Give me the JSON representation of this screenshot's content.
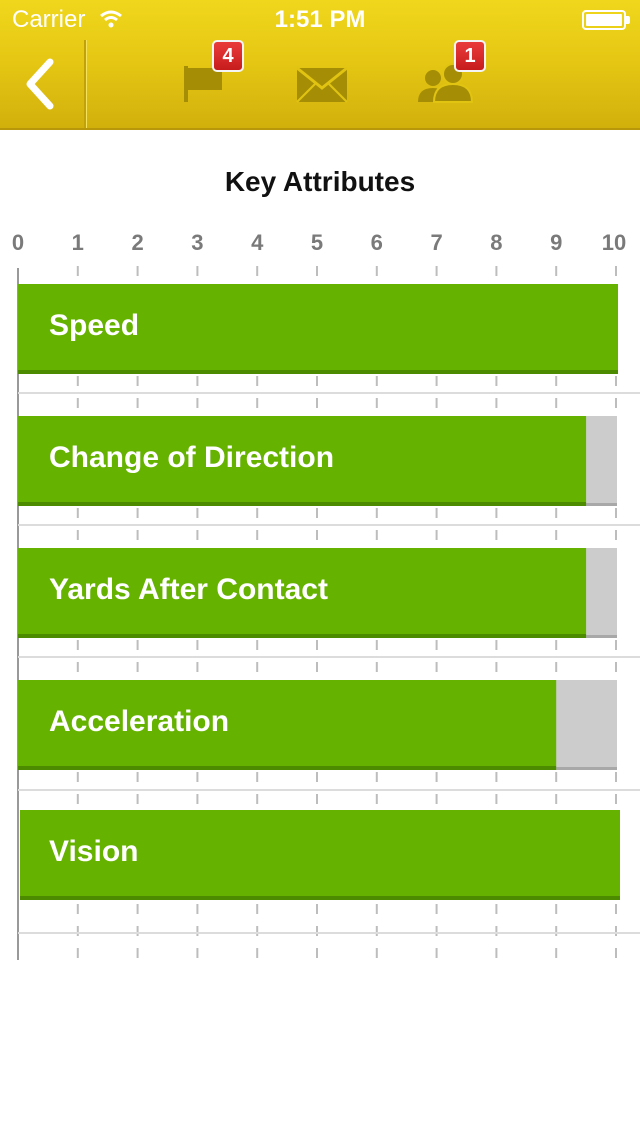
{
  "status_bar": {
    "carrier": "Carrier",
    "time": "1:51 PM"
  },
  "nav": {
    "flag_badge": "4",
    "people_badge": "1"
  },
  "colors": {
    "topbar": "#e6c814",
    "bar_fill": "#66b200",
    "bar_remainder": "#cccccc",
    "badge": "#d52626",
    "icon": "#a58e05"
  },
  "chart_data": {
    "type": "bar",
    "orientation": "horizontal",
    "title": "Key Attributes",
    "xlim": [
      0,
      10
    ],
    "ticks": [
      "0",
      "1",
      "2",
      "3",
      "4",
      "5",
      "6",
      "7",
      "8",
      "9",
      "10"
    ],
    "grid": true,
    "categories": [
      "Speed",
      "Change of Direction",
      "Yards After Contact",
      "Acceleration",
      "Vision"
    ],
    "values": [
      10,
      9.5,
      9.5,
      9,
      10
    ]
  }
}
